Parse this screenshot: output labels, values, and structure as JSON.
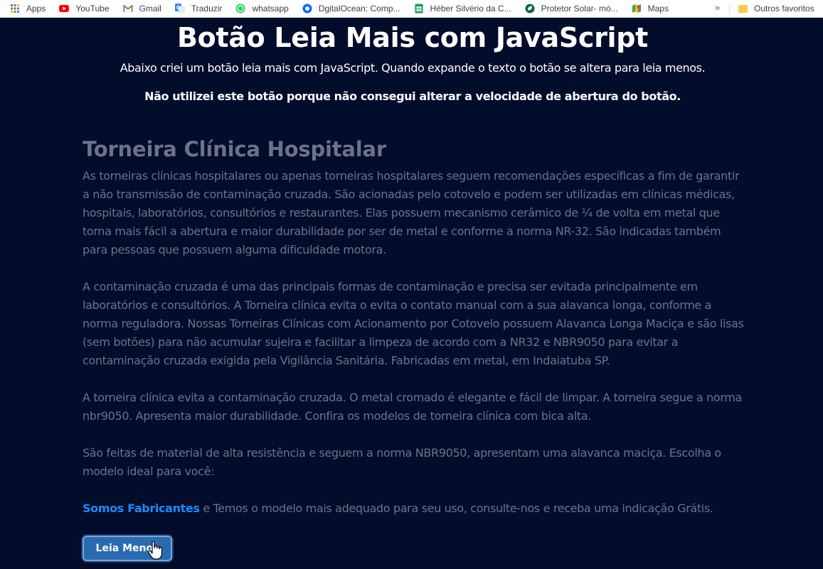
{
  "bookmarks": [
    {
      "label": "Apps",
      "icon": "apps-grid-icon"
    },
    {
      "label": "YouTube",
      "icon": "youtube-icon"
    },
    {
      "label": "Gmail",
      "icon": "gmail-icon"
    },
    {
      "label": "Traduzir",
      "icon": "translate-icon"
    },
    {
      "label": "whatsapp",
      "icon": "whatsapp-icon"
    },
    {
      "label": "DgitalOcean: Comp...",
      "icon": "digitalocean-icon"
    },
    {
      "label": "Héber Silvério da C...",
      "icon": "sheets-icon"
    },
    {
      "label": "Protetor Solar- mó...",
      "icon": "leaf-icon"
    },
    {
      "label": "Maps",
      "icon": "maps-icon"
    }
  ],
  "overflow_chevron": "»",
  "other_favorites": "Outros favoritos",
  "page": {
    "title": "Botão Leia Mais com JavaScript",
    "subtitle": "Abaixo criei um botão leia mais com JavaScript. Quando expande o texto o botão se altera para leia menos.",
    "note": "Não utilizei este botão porque não consegui alterar a velocidade de abertura do botão."
  },
  "article": {
    "heading": "Torneira Clínica Hospitalar",
    "p1": "As torneiras clínicas hospitalares ou apenas torneiras hospitalares seguem recomendações específicas a fim de garantir a não transmissão de contaminação cruzada. São acionadas pelo cotovelo e podem ser utilizadas em clínicas médicas, hospitais, laboratórios, consultórios e restaurantes. Elas possuem mecanismo cerâmico de ¼ de volta em metal que torna mais fácil a abertura e maior durabilidade por ser de metal e conforme a norma NR-32. São indicadas também para pessoas que possuem alguma dificuldade motora.",
    "p2": "A contaminação cruzada é uma das principais formas de contaminação e precisa ser evitada principalmente em laboratórios e consultórios. A Torneira clínica evita o evita o contato manual com a sua alavanca longa, conforme a norma reguladora. Nossas Torneiras Clínicas com Acionamento por Cotovelo possuem Alavanca Longa Maciça e são lisas (sem botões) para não acumular sujeira e facilitar a limpeza de acordo com a NR32 e NBR9050 para evitar a contaminação cruzada exigida pela Vigilância Sanitária. Fabricadas em metal, em Indaiatuba SP.",
    "p3": "A torneira clínica evita a contaminação cruzada. O metal cromado é elegante e fácil de limpar. A torneira segue a norma nbr9050. Apresenta maior durabilidade. Confira os modelos de torneira clínica com bica alta.",
    "p4": "São feitas de material de alta resistência e seguem a norma NBR9050, apresentam uma alavanca maciça. Escolha o modelo ideal para você:",
    "link": "Somos Fabricantes",
    "p5_rest": " e Temos o modelo mais adequado para seu uso, consulte-nos e receba uma indicação Grátis."
  },
  "button": {
    "label": "Leia Menos"
  },
  "colors": {
    "background": "#020c2b",
    "article_text": "#6c7388",
    "link": "#1a8cff",
    "button": "#2a6bb0"
  }
}
